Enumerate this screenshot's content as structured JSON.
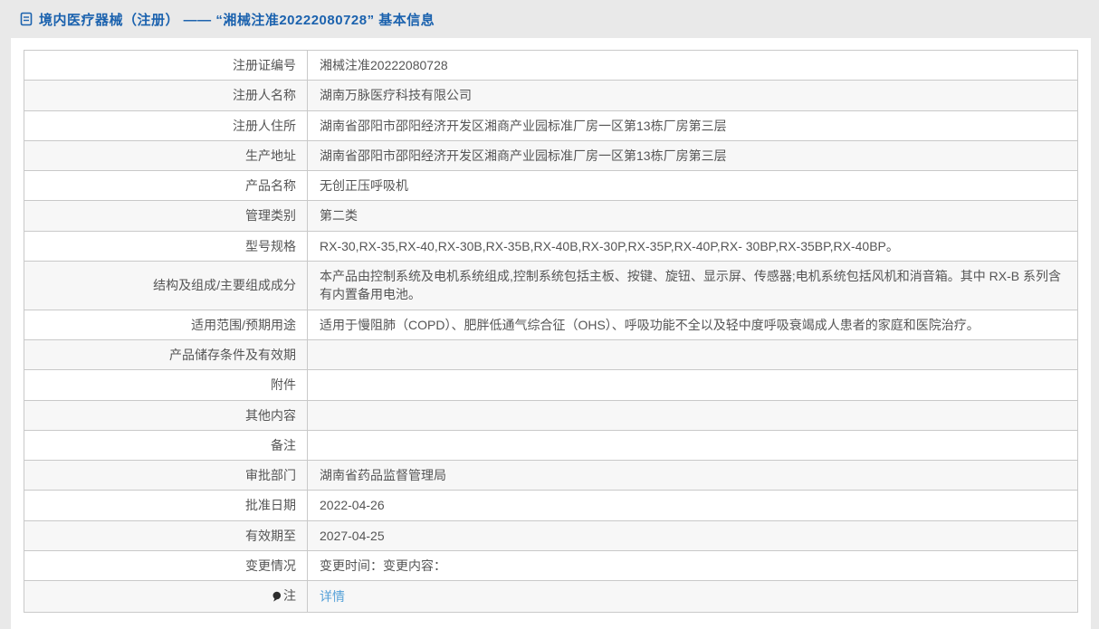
{
  "page": {
    "title": "境内医疗器械（注册） —— “湘械注准20222080728” 基本信息"
  },
  "colors": {
    "page_background": "#e9e9e9",
    "card_background": "#ffffff",
    "title_blue": "#1b62ae",
    "link_blue": "#55a1d8",
    "table_border": "#c9c9c9",
    "zebra_row": "#f7f7f7",
    "text": "#555555"
  },
  "icons": {
    "title_icon": "document-icon",
    "note_icon": "note-bulb-icon"
  },
  "table": {
    "rows": [
      {
        "label": "注册证编号",
        "value": "湘械注准20222080728"
      },
      {
        "label": "注册人名称",
        "value": "湖南万脉医疗科技有限公司"
      },
      {
        "label": "注册人住所",
        "value": "湖南省邵阳市邵阳经济开发区湘商产业园标准厂房一区第13栋厂房第三层"
      },
      {
        "label": "生产地址",
        "value": "湖南省邵阳市邵阳经济开发区湘商产业园标准厂房一区第13栋厂房第三层"
      },
      {
        "label": "产品名称",
        "value": "无创正压呼吸机"
      },
      {
        "label": "管理类别",
        "value": "第二类"
      },
      {
        "label": "型号规格",
        "value": "RX-30,RX-35,RX-40,RX-30B,RX-35B,RX-40B,RX-30P,RX-35P,RX-40P,RX- 30BP,RX-35BP,RX-40BP。"
      },
      {
        "label": "结构及组成/主要组成成分",
        "value": "本产品由控制系统及电机系统组成,控制系统包括主板、按键、旋钮、显示屏、传感器;电机系统包括风机和消音箱。其中 RX-B 系列含有内置备用电池。"
      },
      {
        "label": "适用范围/预期用途",
        "value": "适用于慢阻肺（COPD）、肥胖低通气综合征（OHS）、呼吸功能不全以及轻中度呼吸衰竭成人患者的家庭和医院治疗。"
      },
      {
        "label": "产品储存条件及有效期",
        "value": ""
      },
      {
        "label": "附件",
        "value": ""
      },
      {
        "label": "其他内容",
        "value": ""
      },
      {
        "label": "备注",
        "value": ""
      },
      {
        "label": "审批部门",
        "value": "湖南省药品监督管理局"
      },
      {
        "label": "批准日期",
        "value": "2022-04-26"
      },
      {
        "label": "有效期至",
        "value": "2027-04-25"
      },
      {
        "label": "变更情况",
        "value": "变更时间：变更内容："
      },
      {
        "label": "注",
        "link_text": "详情"
      }
    ]
  }
}
